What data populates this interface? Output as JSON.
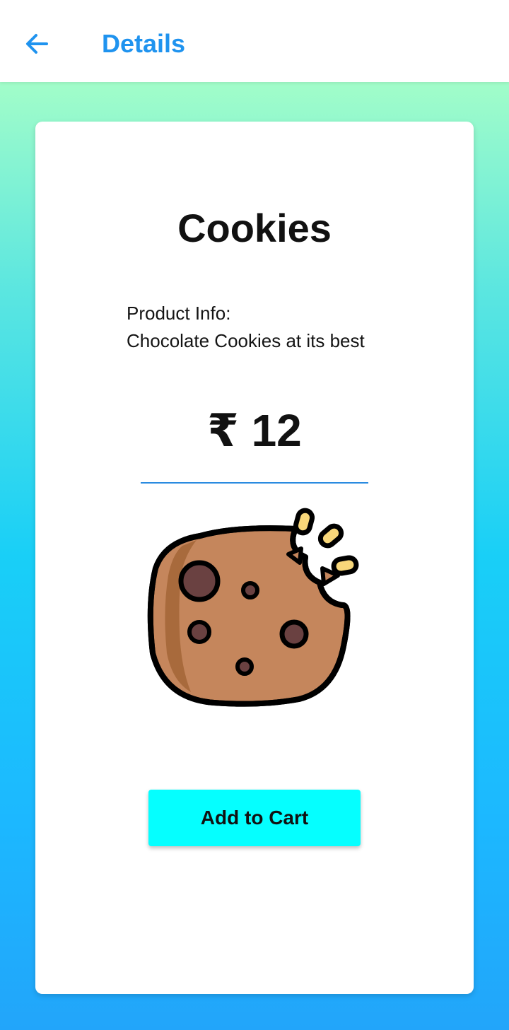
{
  "app_bar": {
    "title": "Details",
    "back_icon": "arrow-left-icon",
    "accent_color": "#1f93ef"
  },
  "product": {
    "name": "Cookies",
    "info_label": "Product Info:",
    "info_text": "Chocolate Cookies at its best",
    "price": "₹ 12",
    "image_icon": "cookie-icon"
  },
  "actions": {
    "add_to_cart_label": "Add to Cart",
    "button_color": "#05ffff"
  },
  "background": {
    "gradient_top": "#a2fdc9",
    "gradient_bottom": "#22a5fa"
  }
}
